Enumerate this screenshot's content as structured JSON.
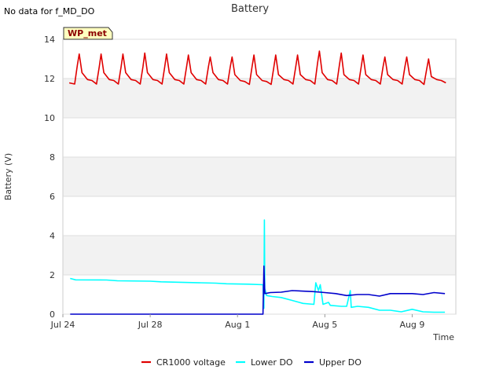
{
  "header": {
    "no_data_note": "No data for f_MD_DO"
  },
  "chart_data": {
    "type": "line",
    "title": "Battery",
    "xlabel": "Time",
    "ylabel": "Battery (V)",
    "tag_label": "WP_met",
    "ylim": [
      0,
      14
    ],
    "xlim": [
      "2023-07-24",
      "2023-08-11"
    ],
    "y_ticks": [
      0,
      2,
      4,
      6,
      8,
      10,
      12,
      14
    ],
    "x_ticks": [
      {
        "date": "2023-07-24",
        "label": "Jul 24"
      },
      {
        "date": "2023-07-28",
        "label": "Jul 28"
      },
      {
        "date": "2023-08-01",
        "label": "Aug 1"
      },
      {
        "date": "2023-08-05",
        "label": "Aug 5"
      },
      {
        "date": "2023-08-09",
        "label": "Aug 9"
      }
    ],
    "grid": "horizontal alternating bands",
    "legend_position": "bottom",
    "series": [
      {
        "name": "CR1000 voltage",
        "color": "#e00000",
        "points": [
          [
            "2023-07-24T07:00",
            11.78
          ],
          [
            "2023-07-24T13:00",
            11.72
          ],
          [
            "2023-07-24T16:00",
            12.7
          ],
          [
            "2023-07-24T18:00",
            13.25
          ],
          [
            "2023-07-24T21:00",
            12.3
          ],
          [
            "2023-07-25T03:00",
            11.95
          ],
          [
            "2023-07-25T08:00",
            11.9
          ],
          [
            "2023-07-25T13:00",
            11.72
          ],
          [
            "2023-07-25T16:00",
            12.6
          ],
          [
            "2023-07-25T18:00",
            13.25
          ],
          [
            "2023-07-25T21:00",
            12.3
          ],
          [
            "2023-07-26T03:00",
            11.95
          ],
          [
            "2023-07-26T08:00",
            11.9
          ],
          [
            "2023-07-26T13:00",
            11.72
          ],
          [
            "2023-07-26T16:00",
            12.6
          ],
          [
            "2023-07-26T18:00",
            13.25
          ],
          [
            "2023-07-26T21:00",
            12.3
          ],
          [
            "2023-07-27T03:00",
            11.95
          ],
          [
            "2023-07-27T08:00",
            11.9
          ],
          [
            "2023-07-27T13:00",
            11.72
          ],
          [
            "2023-07-27T16:00",
            12.6
          ],
          [
            "2023-07-27T18:00",
            13.3
          ],
          [
            "2023-07-27T21:00",
            12.3
          ],
          [
            "2023-07-28T03:00",
            11.95
          ],
          [
            "2023-07-28T08:00",
            11.9
          ],
          [
            "2023-07-28T13:00",
            11.72
          ],
          [
            "2023-07-28T16:00",
            12.6
          ],
          [
            "2023-07-28T18:00",
            13.25
          ],
          [
            "2023-07-28T21:00",
            12.3
          ],
          [
            "2023-07-29T03:00",
            11.95
          ],
          [
            "2023-07-29T08:00",
            11.9
          ],
          [
            "2023-07-29T13:00",
            11.72
          ],
          [
            "2023-07-29T16:00",
            12.6
          ],
          [
            "2023-07-29T18:00",
            13.2
          ],
          [
            "2023-07-29T21:00",
            12.3
          ],
          [
            "2023-07-30T03:00",
            11.95
          ],
          [
            "2023-07-30T08:00",
            11.9
          ],
          [
            "2023-07-30T13:00",
            11.72
          ],
          [
            "2023-07-30T16:00",
            12.6
          ],
          [
            "2023-07-30T18:00",
            13.1
          ],
          [
            "2023-07-30T21:00",
            12.3
          ],
          [
            "2023-07-31T03:00",
            11.95
          ],
          [
            "2023-07-31T08:00",
            11.9
          ],
          [
            "2023-07-31T13:00",
            11.72
          ],
          [
            "2023-07-31T16:00",
            12.6
          ],
          [
            "2023-07-31T18:00",
            13.1
          ],
          [
            "2023-07-31T21:00",
            12.2
          ],
          [
            "2023-08-01T03:00",
            11.9
          ],
          [
            "2023-08-01T08:00",
            11.85
          ],
          [
            "2023-08-01T13:00",
            11.7
          ],
          [
            "2023-08-01T16:00",
            12.6
          ],
          [
            "2023-08-01T18:00",
            13.2
          ],
          [
            "2023-08-01T21:00",
            12.2
          ],
          [
            "2023-08-02T03:00",
            11.9
          ],
          [
            "2023-08-02T08:00",
            11.85
          ],
          [
            "2023-08-02T13:00",
            11.7
          ],
          [
            "2023-08-02T16:00",
            12.6
          ],
          [
            "2023-08-02T18:00",
            13.2
          ],
          [
            "2023-08-02T21:00",
            12.2
          ],
          [
            "2023-08-03T03:00",
            11.95
          ],
          [
            "2023-08-03T08:00",
            11.9
          ],
          [
            "2023-08-03T13:00",
            11.72
          ],
          [
            "2023-08-03T16:00",
            12.6
          ],
          [
            "2023-08-03T18:00",
            13.2
          ],
          [
            "2023-08-03T21:00",
            12.2
          ],
          [
            "2023-08-04T03:00",
            11.95
          ],
          [
            "2023-08-04T08:00",
            11.9
          ],
          [
            "2023-08-04T13:00",
            11.72
          ],
          [
            "2023-08-04T16:00",
            12.8
          ],
          [
            "2023-08-04T18:00",
            13.4
          ],
          [
            "2023-08-04T21:00",
            12.3
          ],
          [
            "2023-08-05T03:00",
            11.95
          ],
          [
            "2023-08-05T08:00",
            11.9
          ],
          [
            "2023-08-05T13:00",
            11.72
          ],
          [
            "2023-08-05T16:00",
            12.7
          ],
          [
            "2023-08-05T18:00",
            13.3
          ],
          [
            "2023-08-05T21:00",
            12.2
          ],
          [
            "2023-08-06T03:00",
            11.95
          ],
          [
            "2023-08-06T08:00",
            11.9
          ],
          [
            "2023-08-06T13:00",
            11.72
          ],
          [
            "2023-08-06T16:00",
            12.6
          ],
          [
            "2023-08-06T18:00",
            13.2
          ],
          [
            "2023-08-06T21:00",
            12.2
          ],
          [
            "2023-08-07T03:00",
            11.95
          ],
          [
            "2023-08-07T08:00",
            11.9
          ],
          [
            "2023-08-07T13:00",
            11.72
          ],
          [
            "2023-08-07T16:00",
            12.6
          ],
          [
            "2023-08-07T18:00",
            13.1
          ],
          [
            "2023-08-07T21:00",
            12.2
          ],
          [
            "2023-08-08T03:00",
            11.95
          ],
          [
            "2023-08-08T08:00",
            11.9
          ],
          [
            "2023-08-08T13:00",
            11.72
          ],
          [
            "2023-08-08T16:00",
            12.6
          ],
          [
            "2023-08-08T18:00",
            13.1
          ],
          [
            "2023-08-08T21:00",
            12.2
          ],
          [
            "2023-08-09T03:00",
            11.95
          ],
          [
            "2023-08-09T08:00",
            11.9
          ],
          [
            "2023-08-09T13:00",
            11.7
          ],
          [
            "2023-08-09T16:00",
            12.5
          ],
          [
            "2023-08-09T18:00",
            13.0
          ],
          [
            "2023-08-09T21:00",
            12.1
          ],
          [
            "2023-08-10T03:00",
            11.95
          ],
          [
            "2023-08-10T08:00",
            11.9
          ],
          [
            "2023-08-10T13:00",
            11.78
          ]
        ]
      },
      {
        "name": "Lower DO",
        "color": "#00ffff",
        "points": [
          [
            "2023-07-24T08:00",
            1.82
          ],
          [
            "2023-07-24T14:00",
            1.75
          ],
          [
            "2023-07-26T00:00",
            1.74
          ],
          [
            "2023-07-26T12:00",
            1.7
          ],
          [
            "2023-07-28T00:00",
            1.68
          ],
          [
            "2023-07-28T12:00",
            1.65
          ],
          [
            "2023-07-31T00:00",
            1.58
          ],
          [
            "2023-07-31T12:00",
            1.55
          ],
          [
            "2023-08-01T12:00",
            1.53
          ],
          [
            "2023-08-02T04:00",
            1.5
          ],
          [
            "2023-08-02T05:00",
            0.3
          ],
          [
            "2023-08-02T05:30",
            4.8
          ],
          [
            "2023-08-02T06:00",
            1.3
          ],
          [
            "2023-08-02T08:00",
            0.95
          ],
          [
            "2023-08-02T14:00",
            0.9
          ],
          [
            "2023-08-03T00:00",
            0.85
          ],
          [
            "2023-08-03T12:00",
            0.7
          ],
          [
            "2023-08-04T00:00",
            0.55
          ],
          [
            "2023-08-04T12:00",
            0.5
          ],
          [
            "2023-08-04T14:00",
            1.6
          ],
          [
            "2023-08-04T17:00",
            1.2
          ],
          [
            "2023-08-04T19:00",
            1.5
          ],
          [
            "2023-08-04T22:00",
            0.5
          ],
          [
            "2023-08-05T04:00",
            0.6
          ],
          [
            "2023-08-05T06:00",
            0.45
          ],
          [
            "2023-08-05T18:00",
            0.4
          ],
          [
            "2023-08-06T00:00",
            0.4
          ],
          [
            "2023-08-06T04:00",
            1.2
          ],
          [
            "2023-08-06T05:00",
            0.35
          ],
          [
            "2023-08-06T12:00",
            0.4
          ],
          [
            "2023-08-07T00:00",
            0.35
          ],
          [
            "2023-08-07T12:00",
            0.2
          ],
          [
            "2023-08-08T00:00",
            0.2
          ],
          [
            "2023-08-08T12:00",
            0.12
          ],
          [
            "2023-08-09T00:00",
            0.25
          ],
          [
            "2023-08-09T12:00",
            0.12
          ],
          [
            "2023-08-10T00:00",
            0.1
          ],
          [
            "2023-08-10T12:00",
            0.1
          ]
        ]
      },
      {
        "name": "Upper DO",
        "color": "#0000cc",
        "points": [
          [
            "2023-07-24T08:00",
            0.0
          ],
          [
            "2023-08-02T04:00",
            0.0
          ],
          [
            "2023-08-02T05:00",
            2.45
          ],
          [
            "2023-08-02T06:00",
            1.05
          ],
          [
            "2023-08-02T12:00",
            1.1
          ],
          [
            "2023-08-03T00:00",
            1.12
          ],
          [
            "2023-08-03T12:00",
            1.2
          ],
          [
            "2023-08-04T12:00",
            1.15
          ],
          [
            "2023-08-05T00:00",
            1.1
          ],
          [
            "2023-08-05T12:00",
            1.05
          ],
          [
            "2023-08-06T00:00",
            0.95
          ],
          [
            "2023-08-06T12:00",
            1.0
          ],
          [
            "2023-08-07T00:00",
            1.0
          ],
          [
            "2023-08-07T12:00",
            0.92
          ],
          [
            "2023-08-08T00:00",
            1.05
          ],
          [
            "2023-08-08T12:00",
            1.05
          ],
          [
            "2023-08-09T00:00",
            1.05
          ],
          [
            "2023-08-09T12:00",
            1.0
          ],
          [
            "2023-08-10T00:00",
            1.1
          ],
          [
            "2023-08-10T12:00",
            1.05
          ]
        ]
      }
    ]
  }
}
